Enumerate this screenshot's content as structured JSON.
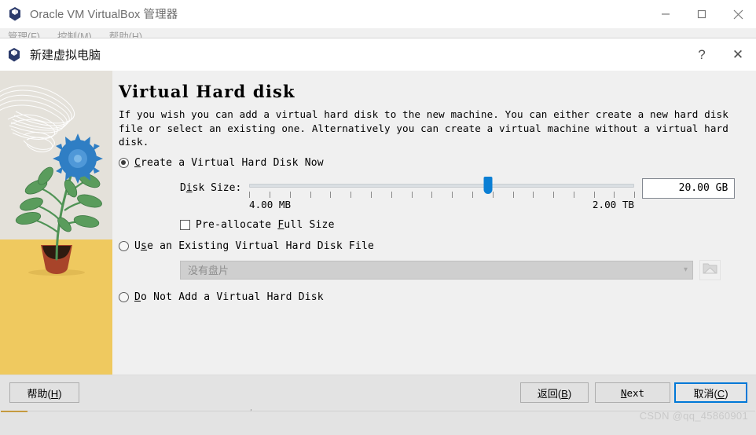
{
  "parent_window": {
    "title": "Oracle VM VirtualBox 管理器",
    "icon": "virtualbox-icon",
    "controls": {
      "minimize": "minimize-icon",
      "maximize": "maximize-icon",
      "close": "close-icon"
    },
    "menubar": [
      {
        "label": "管理(F)"
      },
      {
        "label": "控制(M)"
      },
      {
        "label": "帮助(H)"
      }
    ],
    "watermark": "CSDN @qq_45860901"
  },
  "dialog": {
    "title": "新建虚拟电脑",
    "icon": "virtualbox-icon",
    "help_button": "?",
    "close_button": "✕",
    "page_title": "Virtual Hard disk",
    "description": "If you wish you can add a virtual hard disk to the new machine. You can either create a new hard disk file or select an existing one. Alternatively you can create a virtual machine without a virtual hard disk.",
    "options": [
      {
        "id": "create-now",
        "label_pre": "",
        "mnemonic": "C",
        "label_post": "reate a Virtual Hard Disk Now",
        "selected": true
      },
      {
        "id": "use-existing",
        "label_pre": "U",
        "mnemonic": "s",
        "label_post": "e an Existing Virtual Hard Disk File",
        "selected": false
      },
      {
        "id": "do-not-add",
        "label_pre": "",
        "mnemonic": "D",
        "label_post": "o Not Add a Virtual Hard Disk",
        "selected": false
      }
    ],
    "disk_size": {
      "label_pre": "D",
      "label_mnemonic": "i",
      "label_post": "sk Size:",
      "value": "20.00 GB",
      "min_label": "4.00 MB",
      "max_label": "2.00 TB",
      "handle_percent": 62,
      "tick_count": 20
    },
    "preallocate": {
      "label_pre": "Pre-allocate ",
      "mnemonic": "F",
      "label_post": "ull Size",
      "checked": false
    },
    "existing_disk": {
      "combo_value": "没有盘片",
      "combo_enabled": false,
      "browse_icon": "folder-open-icon"
    },
    "footer": {
      "help": "帮助(H)",
      "help_mnemonic": "H",
      "back": "返回(B)",
      "back_mnemonic": "B",
      "next": "Next",
      "next_mnemonic": "N",
      "cancel": "取消(C)",
      "cancel_mnemonic": "C"
    }
  },
  "colors": {
    "accent_blue": "#0078d7",
    "slider_handle": "#0b7fd4",
    "dialog_bg": "#f0f0f0",
    "footer_bg": "#e3e3e3",
    "art_sky": "#e4e1da",
    "art_ground": "#efc95f",
    "art_flower": "#2f7ec4",
    "art_leaf": "#4f9355",
    "art_pot": "#a8442a"
  }
}
